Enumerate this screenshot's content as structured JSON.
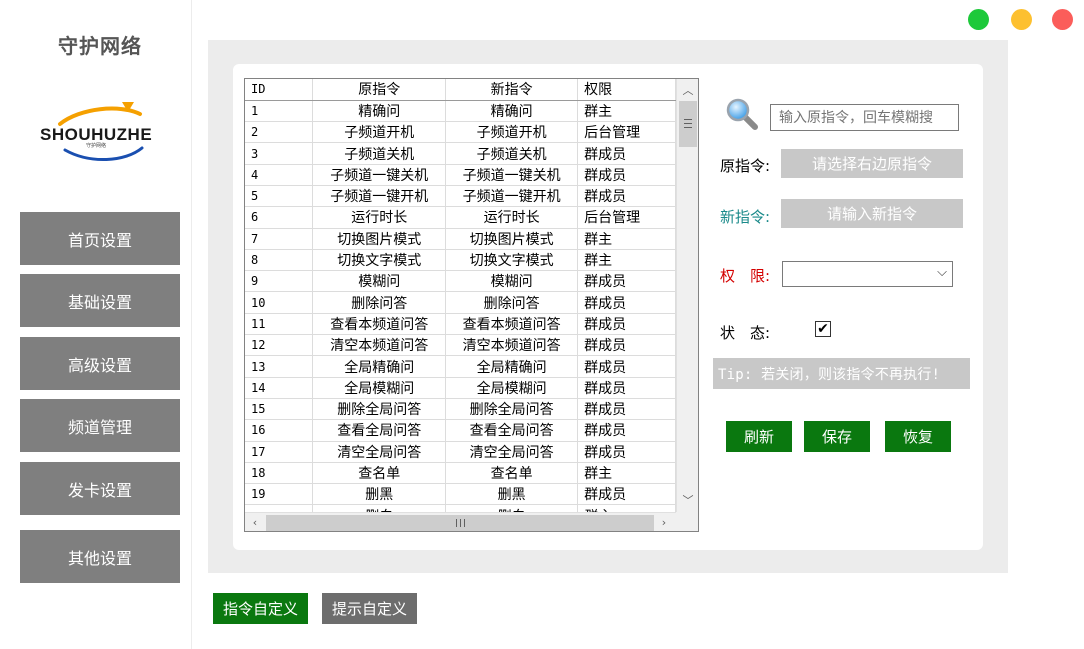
{
  "app": {
    "title": "守护网络",
    "logo_text": "SHOUHUZHE",
    "logo_sub": "守护网络"
  },
  "sidebar": {
    "items": [
      {
        "label": "首页设置"
      },
      {
        "label": "基础设置"
      },
      {
        "label": "高级设置",
        "active": true
      },
      {
        "label": "频道管理"
      },
      {
        "label": "发卡设置"
      },
      {
        "label": "其他设置"
      }
    ]
  },
  "table": {
    "headers": [
      "ID",
      "原指令",
      "新指令",
      "权限"
    ],
    "rows": [
      [
        "1",
        "精确问",
        "精确问",
        "群主"
      ],
      [
        "2",
        "子频道开机",
        "子频道开机",
        "后台管理"
      ],
      [
        "3",
        "子频道关机",
        "子频道关机",
        "群成员"
      ],
      [
        "4",
        "子频道一键关机",
        "子频道一键关机",
        "群成员"
      ],
      [
        "5",
        "子频道一键开机",
        "子频道一键开机",
        "群成员"
      ],
      [
        "6",
        "运行时长",
        "运行时长",
        "后台管理"
      ],
      [
        "7",
        "切换图片模式",
        "切换图片模式",
        "群主"
      ],
      [
        "8",
        "切换文字模式",
        "切换文字模式",
        "群主"
      ],
      [
        "9",
        "模糊问",
        "模糊问",
        "群成员"
      ],
      [
        "10",
        "删除问答",
        "删除问答",
        "群成员"
      ],
      [
        "11",
        "查看本频道问答",
        "查看本频道问答",
        "群成员"
      ],
      [
        "12",
        "清空本频道问答",
        "清空本频道问答",
        "群成员"
      ],
      [
        "13",
        "全局精确问",
        "全局精确问",
        "群成员"
      ],
      [
        "14",
        "全局模糊问",
        "全局模糊问",
        "群成员"
      ],
      [
        "15",
        "删除全局问答",
        "删除全局问答",
        "群成员"
      ],
      [
        "16",
        "查看全局问答",
        "查看全局问答",
        "群成员"
      ],
      [
        "17",
        "清空全局问答",
        "清空全局问答",
        "群成员"
      ],
      [
        "18",
        "查名单",
        "查名单",
        "群主"
      ],
      [
        "19",
        "删黑",
        "删黑",
        "群成员"
      ],
      [
        "",
        "删白",
        "删白",
        "群主"
      ]
    ]
  },
  "form": {
    "search_placeholder": "输入原指令，回车模糊搜",
    "orig_label": "原指令:",
    "orig_value": "请选择右边原指令",
    "new_label": "新指令:",
    "new_value": "请输入新指令",
    "perm_label": "权　限:",
    "perm_value": "",
    "status_label": "状　态:",
    "status_checked": true,
    "tip": "Tip: 若关闭，则该指令不再执行!",
    "refresh_label": "刷新",
    "save_label": "保存",
    "restore_label": "恢复"
  },
  "bottom": {
    "custom_cmd_label": "指令自定义",
    "custom_tip_label": "提示自定义"
  },
  "colors": {
    "accent_active": "#8787ff",
    "nav_bg": "#7f7f7f",
    "green_button": "#0a780f",
    "new_label": "#1a8a8a",
    "perm_label": "#d40000",
    "dot_green": "#1dc93a",
    "dot_yellow": "#fdc02f",
    "dot_red": "#fb5d5a"
  }
}
